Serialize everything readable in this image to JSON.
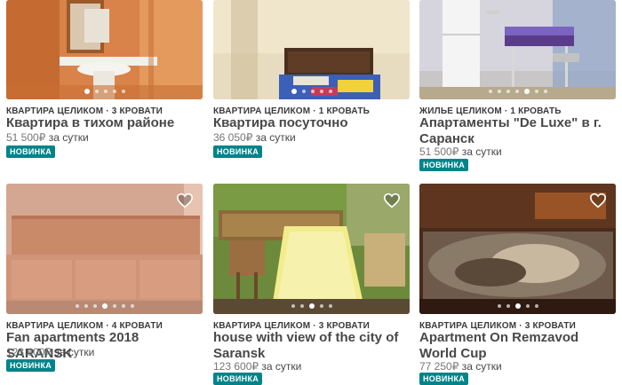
{
  "accent_color": "#008489",
  "listings": [
    {
      "type": "КВАРТИРА ЦЕЛИКОМ · 3 КРОВАТИ",
      "title": "Квартира в тихом районе",
      "price": "51 500₽",
      "per": "за сутки",
      "badge": "НОВИНКА",
      "has_heart": false,
      "active_dot": 0,
      "dot_count": 5,
      "photo_icon": "bathroom-photo"
    },
    {
      "type": "КВАРТИРА ЦЕЛИКОМ · 1 КРОВАТЬ",
      "title": "Квартира посуточно",
      "price": "36 050₽",
      "per": "за сутки",
      "badge": "НОВИНКА",
      "has_heart": false,
      "active_dot": 0,
      "dot_count": 5,
      "photo_icon": "bedroom-photo"
    },
    {
      "type": "ЖИЛЬЕ ЦЕЛИКОМ · 1 КРОВАТЬ",
      "title": "Апартаменты \"De Luxe\" в г. Саранск",
      "price": "51 500₽",
      "per": "за сутки",
      "badge": "НОВИНКА",
      "has_heart": false,
      "active_dot": 4,
      "dot_count": 7,
      "photo_icon": "kitchen-photo"
    },
    {
      "type": "КВАРТИРА ЦЕЛИКОМ · 4 КРОВАТИ",
      "title": "Fan apartments 2018 SARANSK",
      "price": "123 600₽",
      "per": "за сутки",
      "badge": "НОВИНКА",
      "has_heart": true,
      "active_dot": 3,
      "dot_count": 7,
      "photo_icon": "sofa-photo"
    },
    {
      "type": "КВАРТИРА ЦЕЛИКОМ · 3 КРОВАТИ",
      "title": "house with view of the city of Saransk",
      "price": "123 600₽",
      "per": "за сутки",
      "badge": "НОВИНКА",
      "has_heart": true,
      "active_dot": 2,
      "dot_count": 5,
      "photo_icon": "dining-photo"
    },
    {
      "type": "КВАРТИРА ЦЕЛИКОМ · 3 КРОВАТИ",
      "title": "Apartment On Remzavod World Cup",
      "price": "77 250₽",
      "per": "за сутки",
      "badge": "НОВИНКА",
      "has_heart": true,
      "active_dot": 2,
      "dot_count": 5,
      "photo_icon": "bedroom-photo"
    }
  ]
}
